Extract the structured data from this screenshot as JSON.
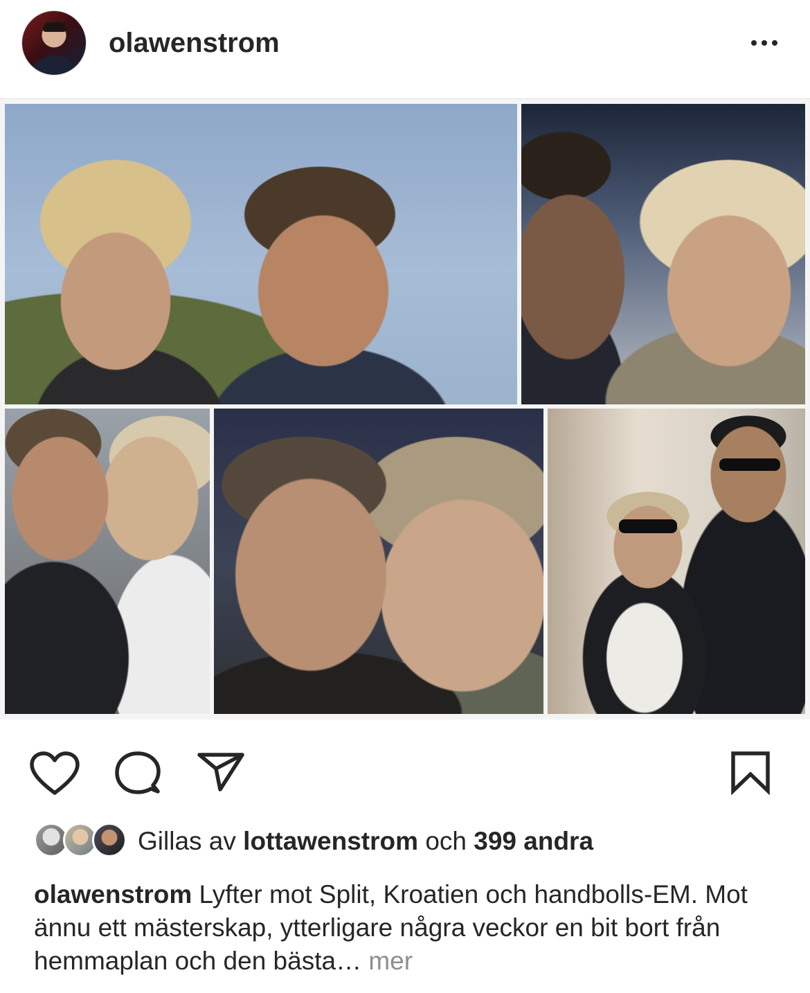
{
  "post": {
    "username": "olawenstrom",
    "more_icon": "ellipsis-icon",
    "photos": [
      {
        "name": "collage-photo-1"
      },
      {
        "name": "collage-photo-2"
      },
      {
        "name": "collage-photo-3"
      },
      {
        "name": "collage-photo-4"
      },
      {
        "name": "collage-photo-5"
      }
    ]
  },
  "actions": {
    "like_icon": "heart-icon",
    "comment_icon": "comment-icon",
    "share_icon": "send-icon",
    "save_icon": "bookmark-icon"
  },
  "likes": {
    "prefix": "Gillas av",
    "liked_by": "lottawenstrom",
    "joiner": "och",
    "others": "399 andra"
  },
  "caption": {
    "username": "olawenstrom",
    "text": "Lyfter mot Split, Kroatien och handbolls-EM. Mot ännu ett mästerskap, ytterligare några veckor en bit bort från hemmaplan och den bästa…",
    "more_label": "mer"
  },
  "colors": {
    "text": "#262626",
    "secondary_text": "#8e8e8e",
    "divider": "#e4e4e4"
  }
}
